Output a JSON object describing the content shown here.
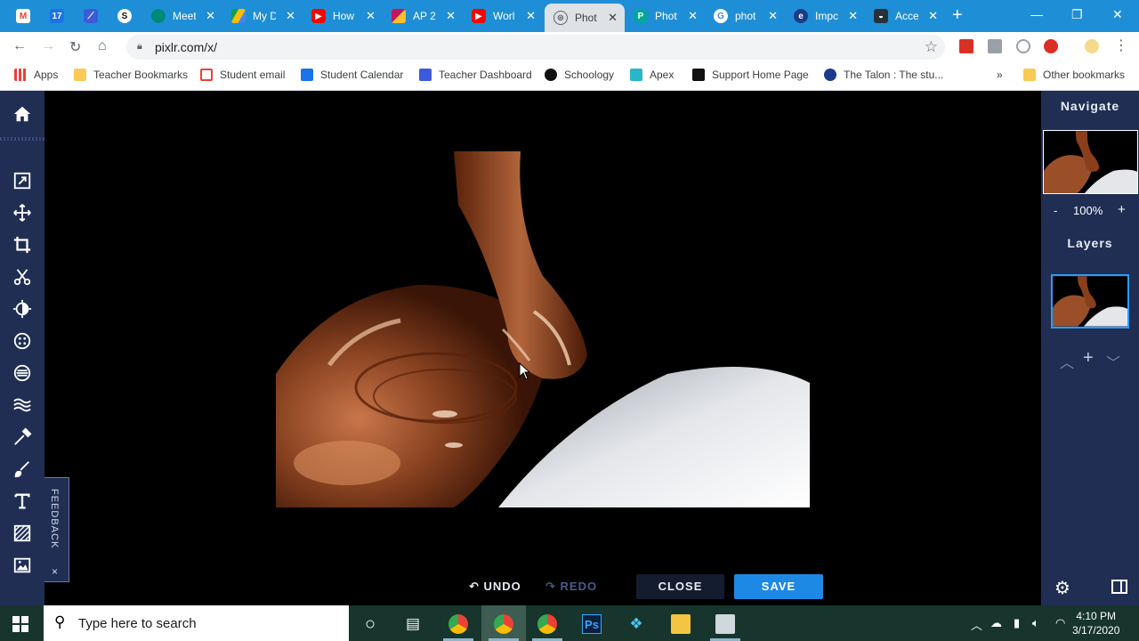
{
  "browser": {
    "tabs": [
      {
        "title": "",
        "icon": "gmail-icon",
        "color": "#ea4335"
      },
      {
        "title": "",
        "icon": "calendar-icon",
        "color": "#1a73e8"
      },
      {
        "title": "",
        "icon": "apex-icon",
        "color": "#3b5bdb"
      },
      {
        "title": "",
        "icon": "schoology-icon",
        "color": "#ffffff"
      },
      {
        "title": "Meet",
        "icon": "meet-icon",
        "color": "#00897b"
      },
      {
        "title": "My D",
        "icon": "drive-icon",
        "color": "#fbbc04"
      },
      {
        "title": "How",
        "icon": "youtube-icon",
        "color": "#ff0000"
      },
      {
        "title": "AP 2",
        "icon": "ap-icon",
        "color": "#c2185b"
      },
      {
        "title": "Worl",
        "icon": "youtube-icon",
        "color": "#ff0000"
      },
      {
        "title": "Phot",
        "icon": "pixlr-icon",
        "color": "#5f6368"
      },
      {
        "title": "Phot",
        "icon": "pixlr-icon",
        "color": "#00a896"
      },
      {
        "title": "phot",
        "icon": "google-icon",
        "color": "#4285f4"
      },
      {
        "title": "Impc",
        "icon": "ie-icon",
        "color": "#1a3a8a"
      },
      {
        "title": "Acce",
        "icon": "access-icon",
        "color": "#263238"
      }
    ],
    "url": "pixlr.com/x/",
    "bookmarks": [
      {
        "label": "Apps",
        "color": "#e94235"
      },
      {
        "label": "Teacher Bookmarks",
        "color": "#f9cb55"
      },
      {
        "label": "Student email",
        "color": "#ea4335"
      },
      {
        "label": "Student Calendar",
        "color": "#1a73e8"
      },
      {
        "label": "Teacher Dashboard",
        "color": "#3b5bdb"
      },
      {
        "label": "Schoology",
        "color": "#111111"
      },
      {
        "label": "Apex",
        "color": "#29b6c9"
      },
      {
        "label": "Support Home Page",
        "color": "#111111"
      },
      {
        "label": "The Talon : The stu...",
        "color": "#1a3a8a"
      }
    ],
    "bookmarks_overflow": "»",
    "other_bookmarks": "Other bookmarks"
  },
  "editor": {
    "navigate_title": "Navigate",
    "zoom_minus": "-",
    "zoom_level": "100%",
    "zoom_plus": "+",
    "layers_title": "Layers",
    "feedback_label": "FEEDBACK",
    "feedback_close": "×",
    "undo_label": "UNDO",
    "redo_label": "REDO",
    "close_label": "CLOSE",
    "save_label": "SAVE",
    "accent_color": "#1e88e5",
    "panel_color": "#202e54"
  },
  "taskbar": {
    "search_placeholder": "Type here to search",
    "time": "4:10 PM",
    "date": "3/17/2020"
  }
}
